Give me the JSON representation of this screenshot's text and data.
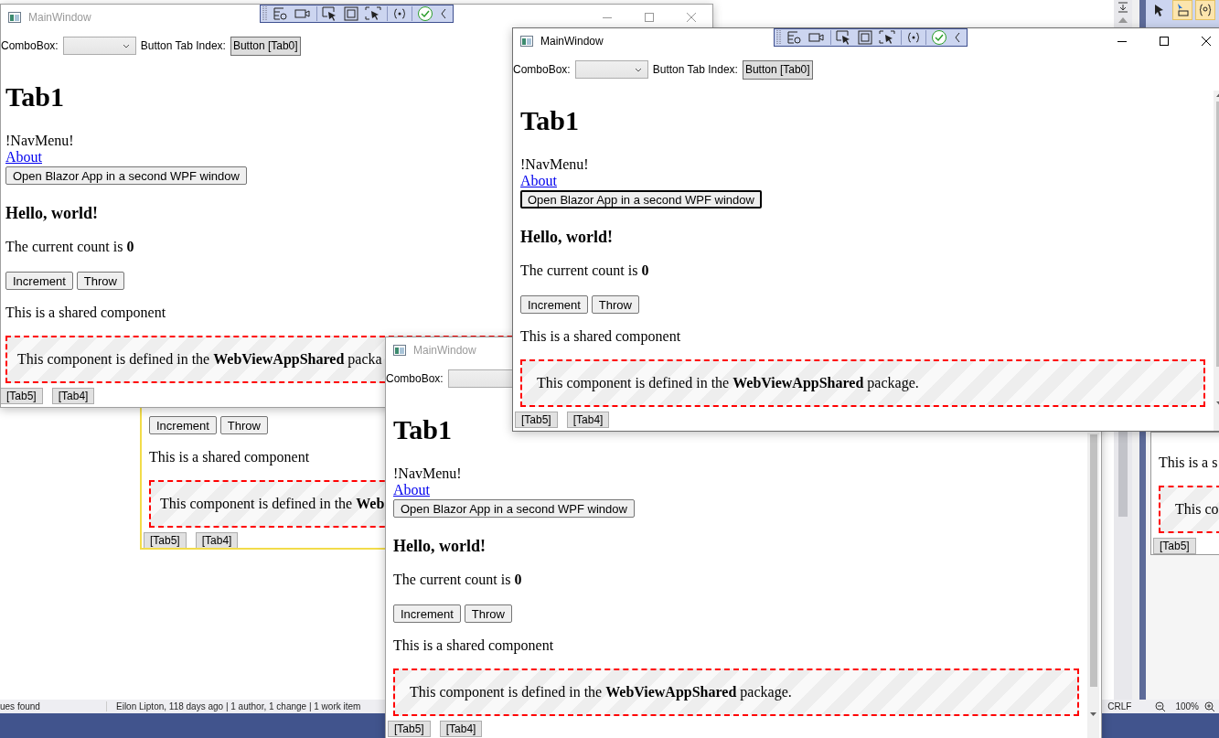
{
  "ide": {
    "status_left": "ues found",
    "status_blame": "Eilon Lipton, 118 days ago | 1 author, 1 change | 1 work item",
    "line_ending": "CRLF",
    "zoom": "100%",
    "tool_buttons": [
      {
        "selected": false
      },
      {
        "selected": true
      },
      {
        "selected": true
      }
    ]
  },
  "windows": [
    {
      "kind": "window",
      "title": "MainWindow",
      "active": false,
      "caption_buttons": true,
      "debug_toolbar": true,
      "combo_label": "ComboBox:",
      "tab_index_label": "Button Tab Index:",
      "tab_index_button": "Button [Tab0]",
      "heading": "Tab1",
      "nav_menu": "!NavMenu!",
      "link": "About",
      "open_button": "Open Blazor App in a second WPF window",
      "open_button_focused": false,
      "hello": "Hello, world!",
      "count_text": "The current count is **0**",
      "buttons": [
        "Increment",
        "Throw"
      ],
      "shared_text": "This is a shared component",
      "banner": "This component is defined in the **WebViewAppShared** packa",
      "tabs": [
        "[Tab5]",
        "[Tab4]"
      ]
    },
    {
      "kind": "fragment",
      "highlighted": true,
      "buttons": [
        "Increment",
        "Throw"
      ],
      "shared_text": "This is a shared component",
      "banner": "This component is defined in the **Web**",
      "tabs": [
        "[Tab5]",
        "[Tab4]"
      ]
    },
    {
      "kind": "window",
      "title": "MainWindow",
      "active": false,
      "combo_label": "ComboBox:",
      "scrollbar": true,
      "heading": "Tab1",
      "nav_menu": "!NavMenu!",
      "link": "About",
      "open_button": "Open Blazor App in a second WPF window",
      "open_button_focused": false,
      "hello": "Hello, world!",
      "count_text": "The current count is **0**",
      "buttons": [
        "Increment",
        "Throw"
      ],
      "shared_text": "This is a shared component",
      "banner": "This component is defined in the **WebViewAppShared** package.",
      "tabs": [
        "[Tab5]",
        "[Tab4]"
      ]
    },
    {
      "kind": "window",
      "title": "MainWindow",
      "active": true,
      "caption_buttons": true,
      "debug_toolbar": true,
      "combo_label": "ComboBox:",
      "tab_index_label": "Button Tab Index:",
      "tab_index_button": "Button [Tab0]",
      "scrollbar": true,
      "heading": "Tab1",
      "nav_menu": "!NavMenu!",
      "link": "About",
      "open_button": "Open Blazor App in a second WPF window",
      "open_button_focused": true,
      "hello": "Hello, world!",
      "count_text": "The current count is **0**",
      "buttons": [
        "Increment",
        "Throw"
      ],
      "shared_text": "This is a shared component",
      "banner": "This component is defined in the **WebViewAppShared** package.",
      "tabs": [
        "[Tab5]",
        "[Tab4]"
      ]
    },
    {
      "kind": "fragment",
      "highlighted": false,
      "shared_text": "This is a s",
      "banner": "This co",
      "tabs": [
        "[Tab5]"
      ]
    }
  ]
}
